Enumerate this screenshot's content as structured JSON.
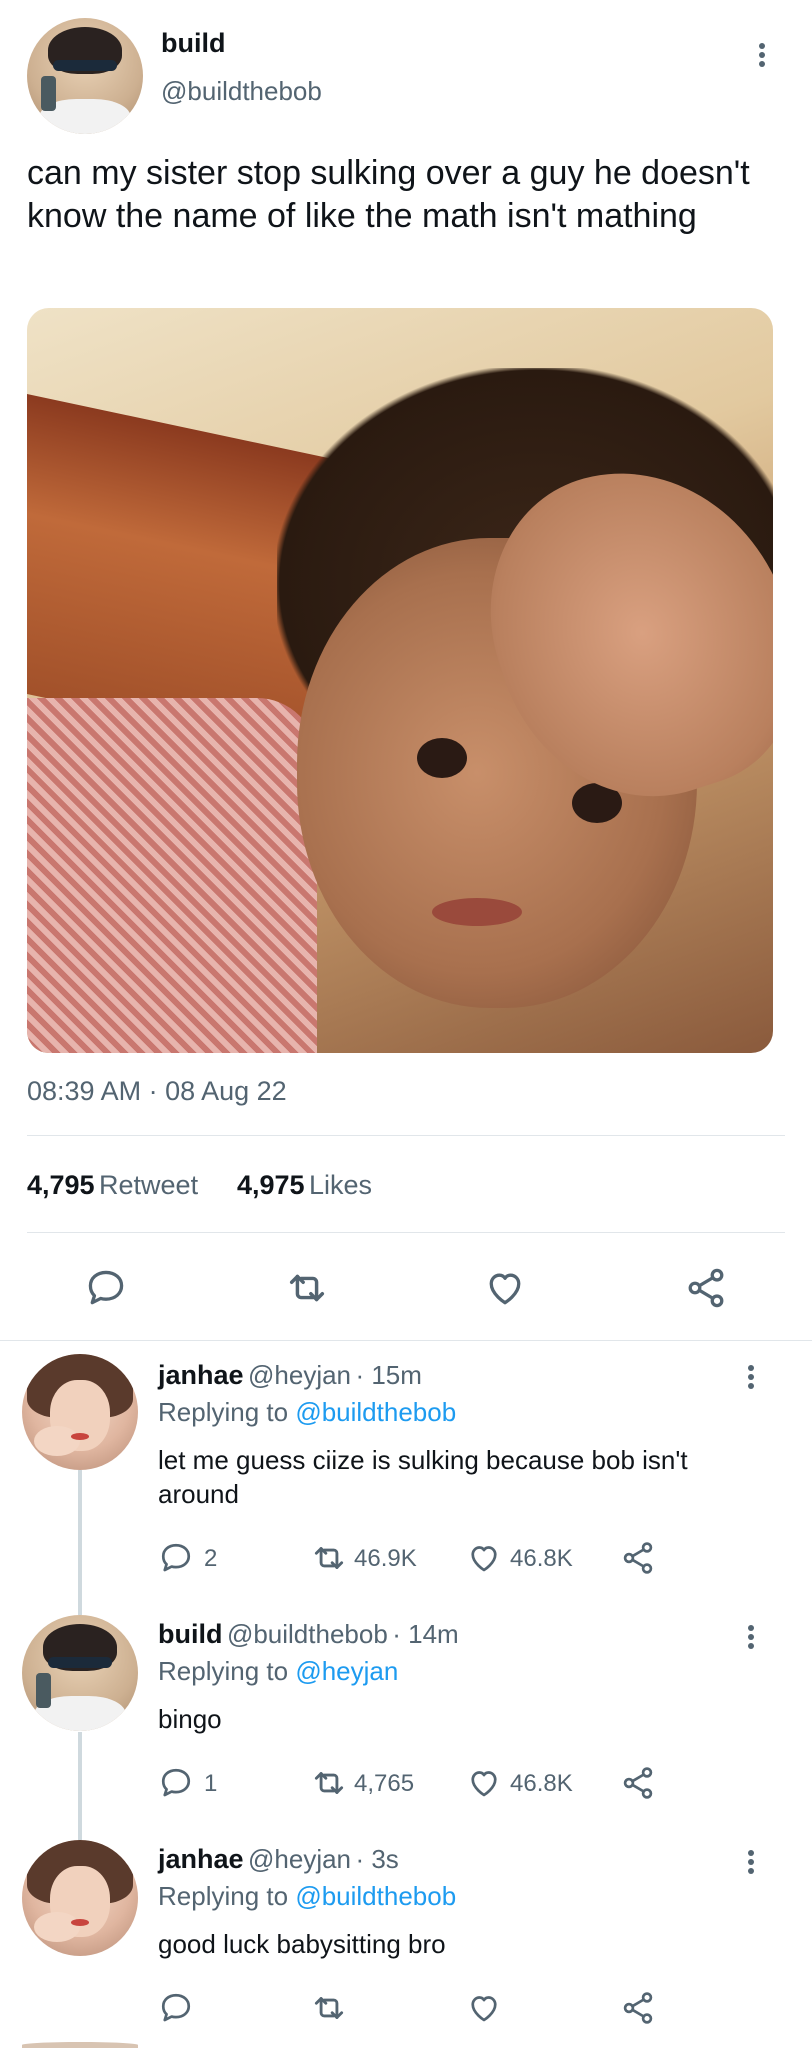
{
  "tweet": {
    "author_name": "build",
    "author_handle": "@buildthebob",
    "text": "can my sister stop sulking over a guy  he doesn't know the name of like the math isn't mathing",
    "timestamp": "08:39 AM · 08 Aug 22",
    "retweet_count": "4,795",
    "retweet_label": "Retweet",
    "likes_count": "4,975",
    "likes_label": "Likes",
    "actions": {
      "reply_icon": "comment-icon",
      "retweet_icon": "retweet-icon",
      "like_icon": "heart-icon",
      "share_icon": "share-icon"
    }
  },
  "replies": [
    {
      "name": "janhae",
      "handle": "@heyjan",
      "time": "· 15m",
      "replying_label": "Replying to",
      "replying_to": "@buildthebob",
      "text": "let me guess ciize is sulking because bob isn't around",
      "reply_count": "2",
      "retweet_count": "46.9K",
      "like_count": "46.8K"
    },
    {
      "name": "build",
      "handle": "@buildthebob",
      "time": "· 14m",
      "replying_label": "Replying to",
      "replying_to": "@heyjan",
      "text": "bingo",
      "reply_count": "1",
      "retweet_count": "4,765",
      "like_count": "46.8K"
    },
    {
      "name": "janhae",
      "handle": "@heyjan",
      "time": "· 3s",
      "replying_label": "Replying to",
      "replying_to": "@buildthebob",
      "text": "good luck babysitting bro",
      "reply_count": "",
      "retweet_count": "",
      "like_count": ""
    }
  ],
  "colors": {
    "link": "#1d9bf0",
    "secondary_text": "#536471",
    "primary_text": "#0f1419",
    "divider": "#e1e6ea"
  }
}
